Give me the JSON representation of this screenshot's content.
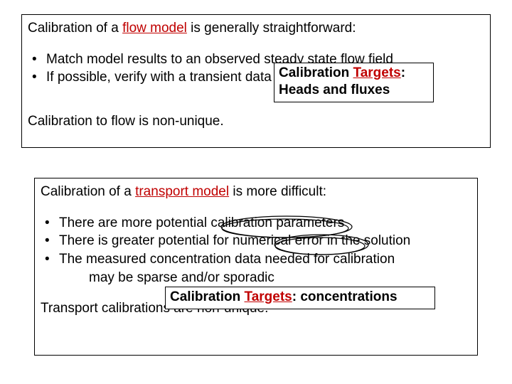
{
  "box1": {
    "intro_pre": "Calibration of a ",
    "intro_hl": "flow model",
    "intro_post": " is generally straightforward:",
    "bullets": [
      "Match model results to an observed steady state flow field",
      "If possible, verify with a transient data set"
    ],
    "closing": "Calibration to flow is non-unique."
  },
  "callout1": {
    "label_plain": "Calibration ",
    "label_target": "Targets",
    "label_colon": ":",
    "line2": "Heads and fluxes"
  },
  "box2": {
    "intro_pre": "Calibration of a ",
    "intro_hl": "transport model",
    "intro_post": " is more difficult:",
    "bullets": [
      "There are more potential calibration parameters",
      "There is greater potential for numerical error in the solution",
      "The measured concentration data needed for calibration"
    ],
    "cont": "may be sparse and/or sporadic",
    "closing": "Transport calibrations are non-unique."
  },
  "callout2": {
    "label_plain": "Calibration ",
    "label_target": "Targets",
    "label_colon": ":",
    "tail": " concentrations"
  }
}
